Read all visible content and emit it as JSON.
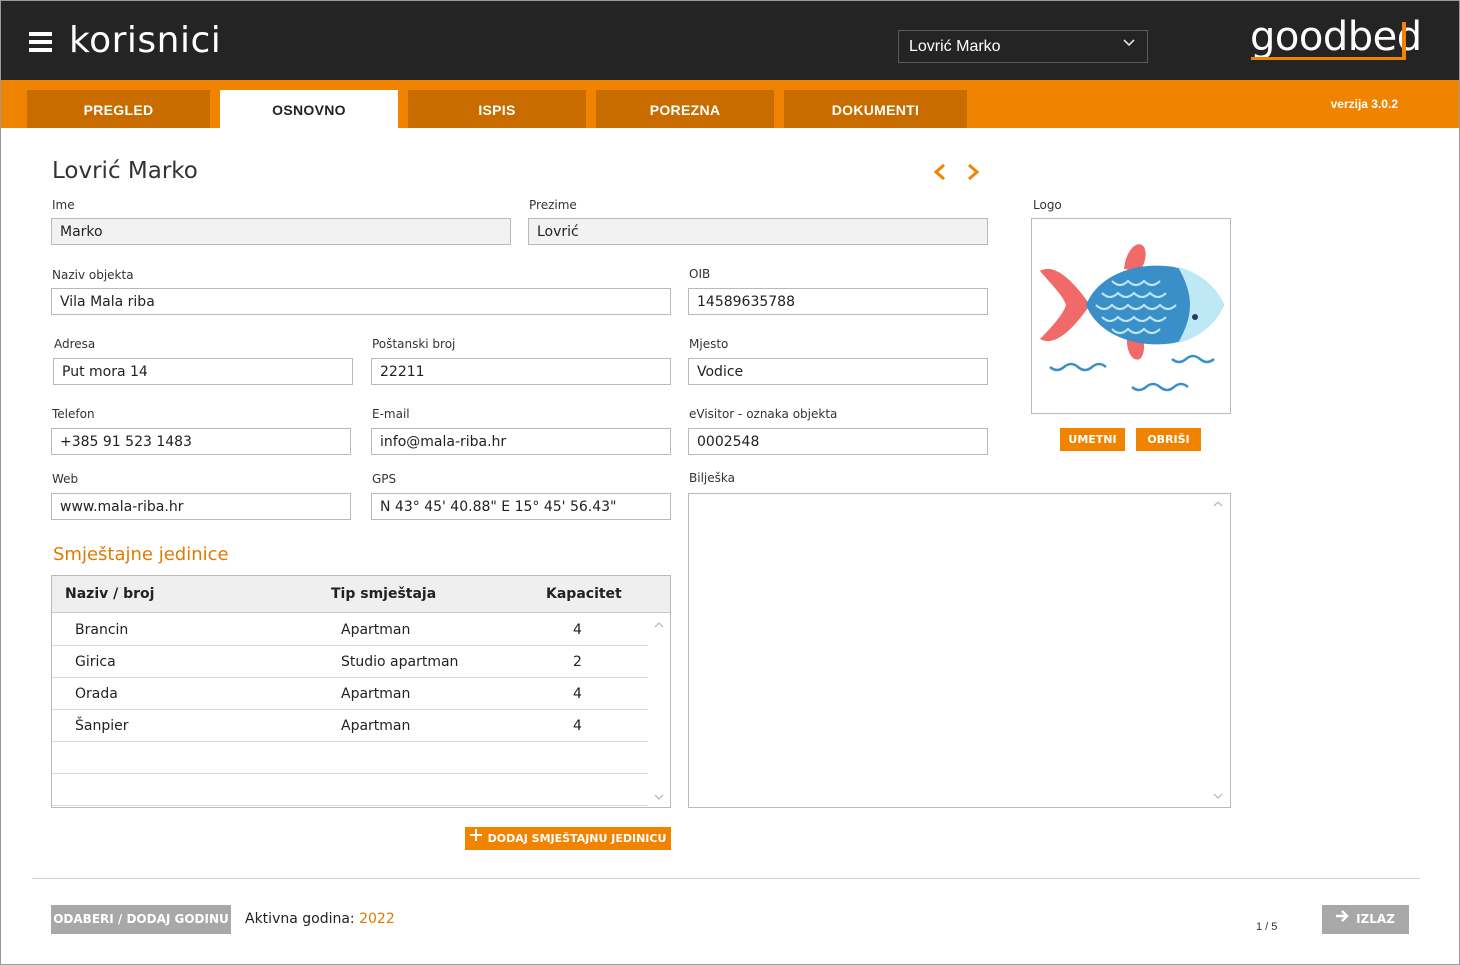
{
  "header": {
    "app_title": "korisnici",
    "selected_user": "Lovrić Marko",
    "logo_text": "goodbed"
  },
  "tabs": [
    {
      "label": "PREGLED",
      "active": false
    },
    {
      "label": "OSNOVNO",
      "active": true
    },
    {
      "label": "ISPIS",
      "active": false
    },
    {
      "label": "POREZNA",
      "active": false
    },
    {
      "label": "DOKUMENTI",
      "active": false
    }
  ],
  "version": "verzija 3.0.2",
  "page_title": "Lovrić Marko",
  "form": {
    "ime": {
      "label": "Ime",
      "value": "Marko"
    },
    "prezime": {
      "label": "Prezime",
      "value": "Lovrić"
    },
    "naziv_objekta": {
      "label": "Naziv objekta",
      "value": "Vila Mala riba"
    },
    "oib": {
      "label": "OIB",
      "value": "14589635788"
    },
    "adresa": {
      "label": "Adresa",
      "value": "Put mora 14"
    },
    "postanski_broj": {
      "label": "Poštanski broj",
      "value": "22211"
    },
    "mjesto": {
      "label": "Mjesto",
      "value": "Vodice"
    },
    "telefon": {
      "label": "Telefon",
      "value": "+385 91 523 1483"
    },
    "email": {
      "label": "E-mail",
      "value": "info@mala-riba.hr"
    },
    "evisitor": {
      "label": "eVisitor - oznaka objekta",
      "value": "0002548"
    },
    "web": {
      "label": "Web",
      "value": "www.mala-riba.hr"
    },
    "gps": {
      "label": "GPS",
      "value": "N 43° 45' 40.88\"  E 15° 45' 56.43\""
    },
    "biljeska": {
      "label": "Bilješka",
      "value": ""
    }
  },
  "logo_panel": {
    "label": "Logo",
    "insert_label": "UMETNI",
    "delete_label": "OBRIŠI"
  },
  "units": {
    "title": "Smještajne jedinice",
    "columns": [
      "Naziv / broj",
      "Tip smještaja",
      "Kapacitet"
    ],
    "rows": [
      {
        "name": "Brancin",
        "type": "Apartman",
        "capacity": "4"
      },
      {
        "name": "Girica",
        "type": "Studio apartman",
        "capacity": "2"
      },
      {
        "name": "Orada",
        "type": "Apartman",
        "capacity": "4"
      },
      {
        "name": "Šanpier",
        "type": "Apartman",
        "capacity": "4"
      }
    ],
    "add_label": "DODAJ SMJEŠTAJNU JEDINICU"
  },
  "footer": {
    "select_year_label": "ODABERI / DODAJ GODINU",
    "active_year_label": "Aktivna godina:",
    "active_year": "2022",
    "pager": "1 / 5",
    "exit_label": "IZLAZ"
  },
  "colors": {
    "accent": "#f08400",
    "tab_inactive": "#c86c00",
    "header_bg": "#242424"
  }
}
